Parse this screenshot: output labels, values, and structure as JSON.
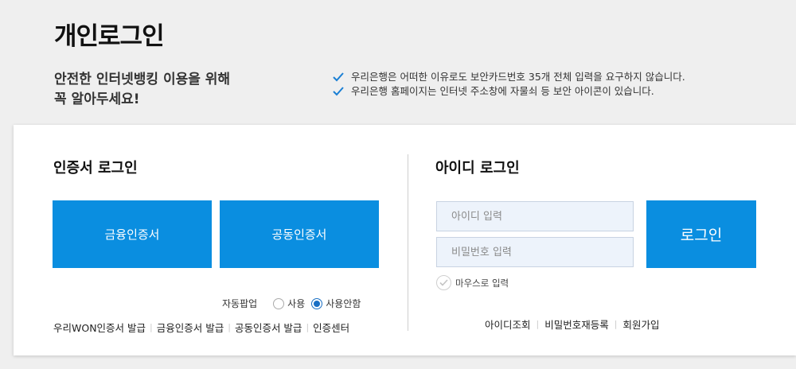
{
  "page": {
    "title": "개인로그인"
  },
  "notice": {
    "heading_line1": "안전한 인터넷뱅킹 이용을 위해",
    "heading_line2": "꼭 알아두세요!",
    "items": [
      "우리은행은 어떠한 이유로도 보안카드번호 35개 전체 입력을 요구하지 않습니다.",
      "우리은행 홈페이지는 인터넷 주소창에 자물쇠 등 보안 아이콘이 있습니다."
    ]
  },
  "cert_login": {
    "title": "인증서 로그인",
    "financial_cert_button": "금융인증서",
    "joint_cert_button": "공동인증서",
    "auto_popup_label": "자동팝업",
    "radio_use": "사용",
    "radio_not_use": "사용안함",
    "selected_option": "사용안함",
    "links": [
      "우리WON인증서 발급",
      "금융인증서 발급",
      "공동인증서 발급",
      "인증센터"
    ]
  },
  "id_login": {
    "title": "아이디 로그인",
    "id_placeholder": "아이디 입력",
    "password_placeholder": "비밀번호 입력",
    "login_button": "로그인",
    "mouse_input_label": "마우스로 입력",
    "links": [
      "아이디조회",
      "비밀번호재등록",
      "회원가입"
    ]
  },
  "colors": {
    "primary_button": "#0a8ee0",
    "check_icon": "#1a7fd4",
    "background": "#efefef",
    "input_background": "#edf3fb"
  },
  "icons": {
    "notice_check": "check-icon",
    "mouse_check": "check-circle-icon"
  }
}
